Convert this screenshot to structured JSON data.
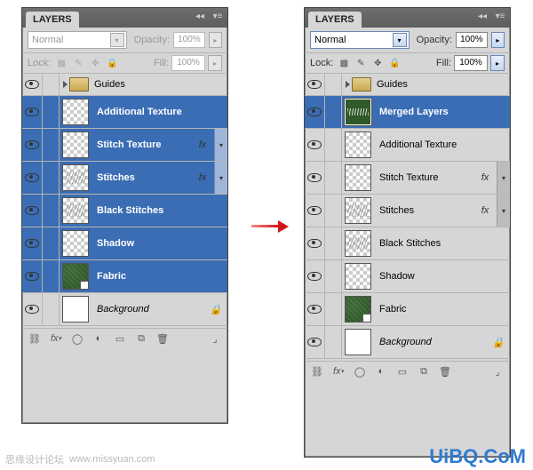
{
  "left_panel": {
    "title": "LAYERS",
    "blend_mode": "Normal",
    "opacity_label": "Opacity:",
    "opacity_value": "100%",
    "lock_label": "Lock:",
    "fill_label": "Fill:",
    "fill_value": "100%",
    "layers": [
      {
        "id": "guides",
        "name": "Guides",
        "type": "group",
        "selected": false
      },
      {
        "id": "addtex",
        "name": "Additional Texture",
        "thumb": "checker",
        "selected": true
      },
      {
        "id": "stitchtex",
        "name": "Stitch Texture",
        "thumb": "checker",
        "selected": true,
        "fx": true
      },
      {
        "id": "stitches",
        "name": "Stitches",
        "thumb": "checker-squiggle",
        "selected": true,
        "fx": true
      },
      {
        "id": "blackstitch",
        "name": "Black Stitches",
        "thumb": "checker-squiggle",
        "selected": true
      },
      {
        "id": "shadow",
        "name": "Shadow",
        "thumb": "checker",
        "selected": true
      },
      {
        "id": "fabric",
        "name": "Fabric",
        "thumb": "fabric",
        "selected": true,
        "clip": true
      },
      {
        "id": "background",
        "name": "Background",
        "thumb": "white",
        "italic": true
      }
    ]
  },
  "right_panel": {
    "title": "LAYERS",
    "blend_mode": "Normal",
    "opacity_label": "Opacity:",
    "opacity_value": "100%",
    "lock_label": "Lock:",
    "fill_label": "Fill:",
    "fill_value": "100%",
    "layers": [
      {
        "id": "guides",
        "name": "Guides",
        "type": "group",
        "selected": false
      },
      {
        "id": "merged",
        "name": "Merged Layers",
        "thumb": "merged",
        "selected": true
      },
      {
        "id": "addtex",
        "name": "Additional Texture",
        "thumb": "checker"
      },
      {
        "id": "stitchtex",
        "name": "Stitch Texture",
        "thumb": "checker",
        "fx": true
      },
      {
        "id": "stitches",
        "name": "Stitches",
        "thumb": "checker-squiggle",
        "fx": true
      },
      {
        "id": "blackstitch",
        "name": "Black Stitches",
        "thumb": "checker-squiggle"
      },
      {
        "id": "shadow",
        "name": "Shadow",
        "thumb": "checker"
      },
      {
        "id": "fabric",
        "name": "Fabric",
        "thumb": "fabric",
        "clip": true
      },
      {
        "id": "background",
        "name": "Background",
        "thumb": "white",
        "italic": true
      }
    ]
  },
  "fx_label": "fx",
  "watermark": {
    "left_cn": "思缘设计论坛",
    "left_url": "www.missyuan.com",
    "right": "UiBQ.CoM"
  }
}
